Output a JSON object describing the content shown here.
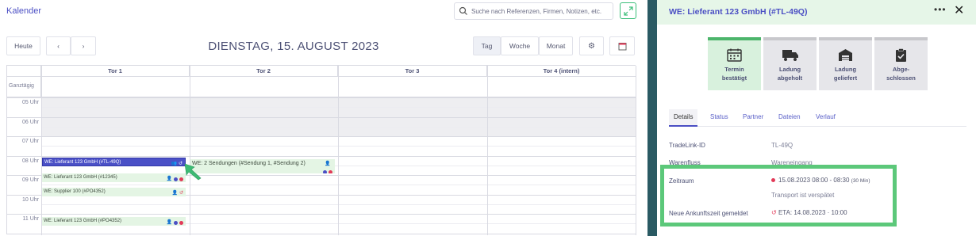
{
  "calendar": {
    "title": "Kalender",
    "search_placeholder": "Suche nach Referenzen, Firmen, Notizen, etc.",
    "today_label": "Heute",
    "date_title": "DIENSTAG, 15. AUGUST 2023",
    "view_day": "Tag",
    "view_week": "Woche",
    "view_month": "Monat",
    "columns": [
      "Tor 1",
      "Tor 2",
      "Tor 3",
      "Tor 4 (intern)"
    ],
    "all_day_label": "Ganztägig",
    "hours": [
      "05 Uhr",
      "06 Uhr",
      "07 Uhr",
      "08 Uhr",
      "09 Uhr",
      "10 Uhr",
      "11 Uhr"
    ],
    "events": [
      {
        "text": "WE: Lieferant 123 GmbH (#TL-49Q)",
        "selected": true
      },
      {
        "text": "WE: Lieferant 123 GmbH (#12345)"
      },
      {
        "text": "WE: Supplier 100 (#PO4352)"
      },
      {
        "text": "WE: Lieferant 123 GmbH (#PO4352)"
      },
      {
        "text": "WE: 2 Sendungen (#Sendung 1, #Sendung 2)"
      }
    ]
  },
  "panel": {
    "title": "WE: Lieferant 123 GmbH (#TL-49Q)",
    "more_label": "•••",
    "close_label": "✕",
    "statuses": [
      {
        "label_line1": "Termin",
        "label_line2": "bestätigt",
        "done": true,
        "icon": "calendar-icon"
      },
      {
        "label_line1": "Ladung",
        "label_line2": "abgeholt",
        "done": false,
        "icon": "truck-icon"
      },
      {
        "label_line1": "Ladung",
        "label_line2": "geliefert",
        "done": false,
        "icon": "warehouse-icon"
      },
      {
        "label_line1": "Abge-",
        "label_line2": "schlossen",
        "done": false,
        "icon": "clipboard-check-icon"
      }
    ],
    "tabs": [
      "Details",
      "Status",
      "Partner",
      "Dateien",
      "Verlauf"
    ],
    "details": {
      "tradelink_label": "TradeLink-ID",
      "tradelink_value": "TL-49Q",
      "warenfluss_label": "Warenfluss",
      "warenfluss_value": "Wareneingang",
      "zeitraum_label": "Zeitraum",
      "zeitraum_value": "15.08.2023 08:00 - 08:30",
      "zeitraum_duration": "(30 Min)",
      "zeitraum_note": "Transport ist verspätet",
      "ankunft_label": "Neue Ankunftszeit gemeldet",
      "ankunft_value": "ETA: 14.08.2023 · 10:00"
    }
  },
  "colors": {
    "accent": "#4b4fc4",
    "success": "#4cb56b",
    "danger": "#e23a58",
    "highlight": "#5cc87a"
  }
}
